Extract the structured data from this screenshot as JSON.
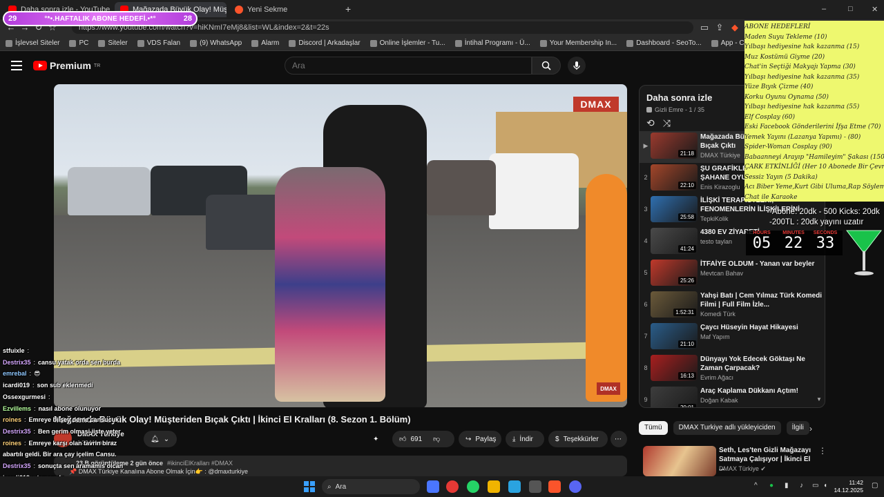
{
  "browser": {
    "tabs": [
      {
        "label": "Daha sonra izle - YouTube"
      },
      {
        "label": "Mağazada Büyük Olay! Müşteri…"
      },
      {
        "label": "Yeni Sekme"
      }
    ],
    "new_tab": "+",
    "url": "https://www.youtube.com/watch?v=hiKNmI7eMj8&list=WL&index=2&t=22s",
    "window_controls": [
      "–",
      "□",
      "✕"
    ]
  },
  "bookmarks": [
    "İşlevsel Siteler",
    "PC",
    "Siteler",
    "VDS Falan",
    "(9) WhatsApp",
    "Alarm",
    "Discord | Arkadaşlar",
    "Online İşlemler - Tu...",
    "İntihal Programı - Ü...",
    "Your Membership In...",
    "Dashboard - SeoTo...",
    "App - Copymatic",
    "IP Sorgulama - IP A..."
  ],
  "overlay_bar": {
    "left": "29",
    "title": "°*•.HAFTALIK ABONE HEDEFİ.•*°",
    "right": "28"
  },
  "yt": {
    "logo": "Premium",
    "logo_sup": "TR",
    "search_placeholder": "Ara",
    "video_title": "Mağazada Büyük Olay! Müşteriden Bıçak Çıktı | İkinci El Kralları (8. Sezon 1. Bölüm)",
    "likes": "691",
    "share": "Paylaş",
    "download": "İndir",
    "thanks": "Teşekkürler",
    "more": "⋯",
    "desc_views": "23 B görüntüleme  2 gün önce",
    "desc_tags": "#ikinciElKralları #DMAX",
    "desc_line2": "📌 DMAX Türkiye Kanalına Abone Olmak İçin👉 : @dmaxturkiye",
    "channel_name": "DMAX Türkiye",
    "channel_subs": "1,32 Mn abone"
  },
  "player": {
    "logo": "DMAX",
    "bug": "DMAX"
  },
  "watch_later": {
    "title": "Daha sonra izle",
    "sub": "Gizli Emre - 1 / 35",
    "items": [
      {
        "idx": "▶",
        "title": "Mağazada Büyük Olay! Müşteriden Bıçak Çıktı",
        "channel": "DMAX Türkiye",
        "dur": "21:18",
        "color": "#9a3a2e"
      },
      {
        "idx": "2",
        "title": "ŞU GRAFİKLERE BAK! YEPYENİ 23 ŞAHANE OYUN",
        "channel": "Enis Kirazoglu",
        "dur": "22:10",
        "color": "#a3462a"
      },
      {
        "idx": "3",
        "title": "İLİŞKİ TERAPİSTLERİ, FENOMENLERİN İLİŞKİLERİNİ",
        "channel": "TepkiKolik",
        "dur": "25:58",
        "color": "#2f6fb0"
      },
      {
        "idx": "4",
        "title": "4380 EV ZİYARETİ",
        "channel": "testo taylan",
        "dur": "41:24",
        "color": "#4a4a4a"
      },
      {
        "idx": "5",
        "title": "İTFAİYE OLDUM - Yanan var beyler",
        "channel": "Mevtcan Bahav",
        "dur": "25:26",
        "color": "#c0392b"
      },
      {
        "idx": "6",
        "title": "Yahşi Batı | Cem Yılmaz Türk Komedi Filmi | Full Film İzle...",
        "channel": "Komedi Türk",
        "dur": "1:52:31",
        "color": "#6b5a3a"
      },
      {
        "idx": "7",
        "title": "Çaycı Hüseyin Hayat Hikayesi",
        "channel": "Maf Yapım",
        "dur": "21:10",
        "color": "#2a5d8a"
      },
      {
        "idx": "8",
        "title": "Dünyayı Yok Edecek Göktaşı Ne Zaman Çarpacak?",
        "channel": "Evrim Ağacı",
        "dur": "16:13",
        "color": "#a81f1f"
      },
      {
        "idx": "9",
        "title": "Araç Kaplama Dükkanı Açtım!",
        "channel": "Doğan Kabak",
        "dur": "20:01",
        "color": "#3d3d3d"
      }
    ]
  },
  "chips": {
    "items": [
      "Tümü",
      "DMAX Turkiye adlı yükleyiciden",
      "İlgili"
    ],
    "next": "›"
  },
  "related": {
    "title": "Seth, Les'ten Gizli Mağazayı Satmaya Çalışıyor | İkinci El ...",
    "channel": "DMAX Türkiye ✔",
    "more": "⋮"
  },
  "goals": [
    "ABONE HEDEFLERİ",
    "Maden Suyu Tekleme (10)",
    "Yılbaşı hediyesine hak kazanma (15)",
    "Muz Kostümü Giyme (20)",
    "Chat'in Seçtiği Makyajı Yapma (30)",
    "Yılbaşı hediyesine hak kazanma (35)",
    "Yüze Bıyık Çizme (40)",
    "Korku Oyunu Oynama (50)",
    "Yılbaşı hediyesine hak kazanma (55)",
    "Elf Cosplay  (60)",
    "Eski Facebook Gönderilerini İfşa Etme (70)",
    "Yemek Yayını (Lazanya Yapımı) - (80)",
    "Spider-Woman Cosplay (90)",
    "Babaanneyi Arayıp \"Hamileyim\" Şakası (150)",
    "ÇARK ETKİNLİĞİ (Her 10 Abonede Bir Çevrilir)",
    "Sessiz Yayın (5 Dakika)",
    "Acı Biber Yeme,Kurt Gibi Uluma,Rap Söyleme",
    "Chat ile Karaoke"
  ],
  "subinfo": {
    "line1": "-Abone: 20dk - 500 Kicks: 20dk",
    "line2": "-200TL : 20dk yayını uzatır"
  },
  "timer": {
    "hours_label": "HOURS",
    "minutes_label": "MINUTES",
    "seconds_label": "SECONDS",
    "hours": "05",
    "minutes": "22",
    "seconds": "33"
  },
  "chat": [
    {
      "user": "stfuixle",
      "color": "#ffffff",
      "text": ""
    },
    {
      "user": "Destrix35",
      "color": "#d6a8ff",
      "text": "cansu yatak orda sen burda"
    },
    {
      "user": "emrebal",
      "color": "#8fc8ff",
      "text": "😎"
    },
    {
      "user": "icardi019",
      "color": "#ffffff",
      "text": "son sub eklenmedi"
    },
    {
      "user": "Ossexgurmesi",
      "color": "#ffffff",
      "text": ""
    },
    {
      "user": "Ezvillems",
      "color": "#b6ff9e",
      "text": "nasıl abone olunuyor"
    },
    {
      "user": "roines",
      "color": "#ffd27a",
      "text": "Emreye biişey deme cansucuk"
    },
    {
      "user": "Destrix35",
      "color": "#d6a8ff",
      "text": "Ben gerim olmasi iiste yeter"
    },
    {
      "user": "roines",
      "color": "#ffd27a",
      "text": "Emreye karşı olan tavrin biraz"
    },
    {
      "user": "",
      "color": "#ffffff",
      "text": "abartılı geldi. Bir ara çay içelim Cansu."
    },
    {
      "user": "Destrix35",
      "color": "#d6a8ff",
      "text": "sonuçta sen aramamis olcan"
    },
    {
      "user": "icardi019",
      "color": "#ffffff",
      "text": "tamamdır"
    },
    {
      "user": "Destrix35",
      "color": "#d6a8ff",
      "text": "lavuk sardı bizi aga ya"
    }
  ],
  "taskbar": {
    "search": "Ara",
    "time": "11:42",
    "date": "14.12.2025"
  }
}
